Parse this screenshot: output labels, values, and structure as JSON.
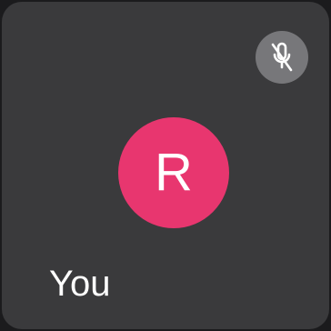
{
  "participant": {
    "name": "You",
    "initial": "R",
    "avatar_color": "#e8366f",
    "muted": true,
    "mute_icon": "microphone-off-icon"
  },
  "colors": {
    "tile_background": "#3a3a3c",
    "badge_background": "#77777a",
    "icon_color": "#ffffff"
  }
}
